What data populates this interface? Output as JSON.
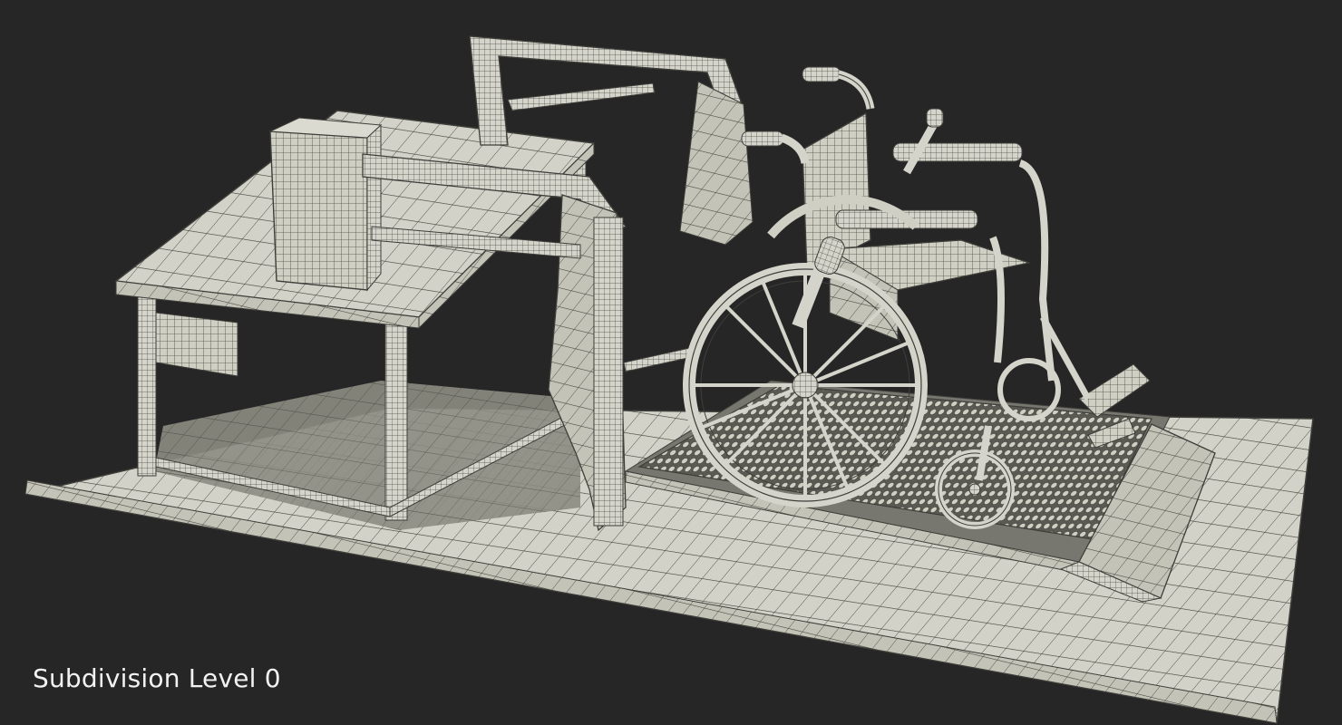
{
  "caption": "Subdivision Level 0",
  "colors": {
    "background": "#262626",
    "model_fill": "#d2d2c8",
    "model_fill_shadow": "#8a8a80",
    "wire": "#3e3e3a",
    "caption_text": "#f2f2f2"
  }
}
